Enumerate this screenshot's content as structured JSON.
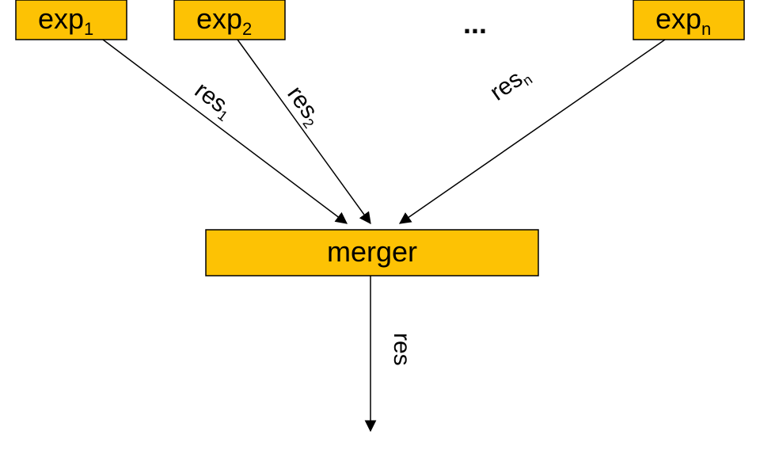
{
  "nodes": {
    "exp1": {
      "base": "exp",
      "sub": "1"
    },
    "exp2": {
      "base": "exp",
      "sub": "2"
    },
    "expn": {
      "base": "exp",
      "sub": "n"
    },
    "merger": {
      "label": "merger"
    }
  },
  "ellipsis": "...",
  "edges": {
    "res1": {
      "base": "res",
      "sub": "1"
    },
    "res2": {
      "base": "res",
      "sub": "2"
    },
    "resn": {
      "base": "res",
      "sub": "n"
    },
    "out": {
      "base": "res",
      "sub": ""
    }
  },
  "colors": {
    "box_fill": "#fdc204",
    "stroke": "#000000"
  }
}
